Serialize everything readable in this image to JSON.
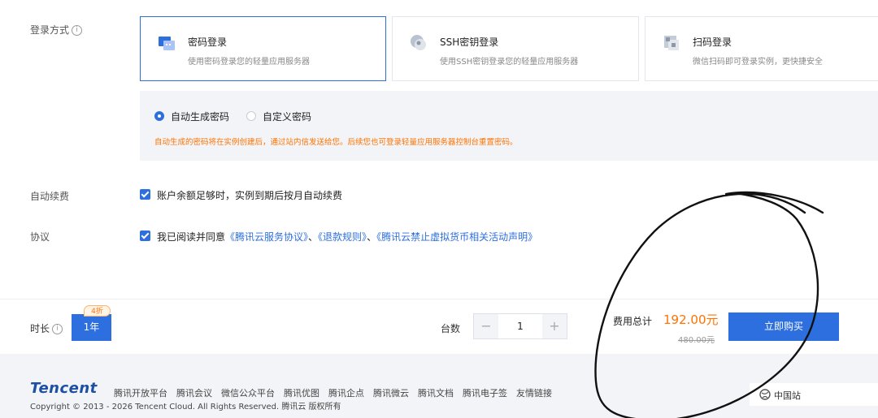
{
  "login": {
    "label": "登录方式",
    "methods": [
      {
        "title": "密码登录",
        "desc": "使用密码登录您的轻量应用服务器",
        "selected": true
      },
      {
        "title": "SSH密钥登录",
        "desc": "使用SSH密钥登录您的轻量应用服务器",
        "selected": false
      },
      {
        "title": "扫码登录",
        "desc": "微信扫码即可登录实例，更快捷安全",
        "selected": false
      }
    ],
    "password_options": [
      {
        "label": "自动生成密码",
        "selected": true
      },
      {
        "label": "自定义密码",
        "selected": false
      }
    ],
    "hint": "自动生成的密码将在实例创建后，通过站内信发送给您。后续您也可登录轻量应用服务器控制台重置密码。"
  },
  "auto_renew": {
    "label": "自动续费",
    "text": "账户余额足够时，实例到期后按月自动续费",
    "checked": true
  },
  "agreement": {
    "label": "协议",
    "prefix": "我已阅读并同意",
    "links": [
      "《腾讯云服务协议》",
      "《退款规则》",
      "《腾讯云禁止虚拟货币相关活动声明》"
    ],
    "sep": "、",
    "checked": true
  },
  "purchase": {
    "duration_label": "时长",
    "duration_value": "1年",
    "discount_badge": "4折",
    "quantity_label": "台数",
    "minus": "−",
    "quantity": "1",
    "plus": "+",
    "total_label": "费用总计",
    "price": "192.00元",
    "original_price": "480.00元",
    "buy_button": "立即购买"
  },
  "footer": {
    "brand": "Tencent",
    "links": [
      "腾讯开放平台",
      "腾讯会议",
      "微信公众平台",
      "腾讯优图",
      "腾讯企点",
      "腾讯微云",
      "腾讯文档",
      "腾讯电子签",
      "友情链接"
    ],
    "copyright": "Copyright © 2013 - 2026 Tencent Cloud. All Rights Reserved. 腾讯云 版权所有",
    "region": "中国站"
  },
  "colors": {
    "accent": "#2d6fde",
    "price": "#ff7200",
    "warning": "#ff7200"
  }
}
